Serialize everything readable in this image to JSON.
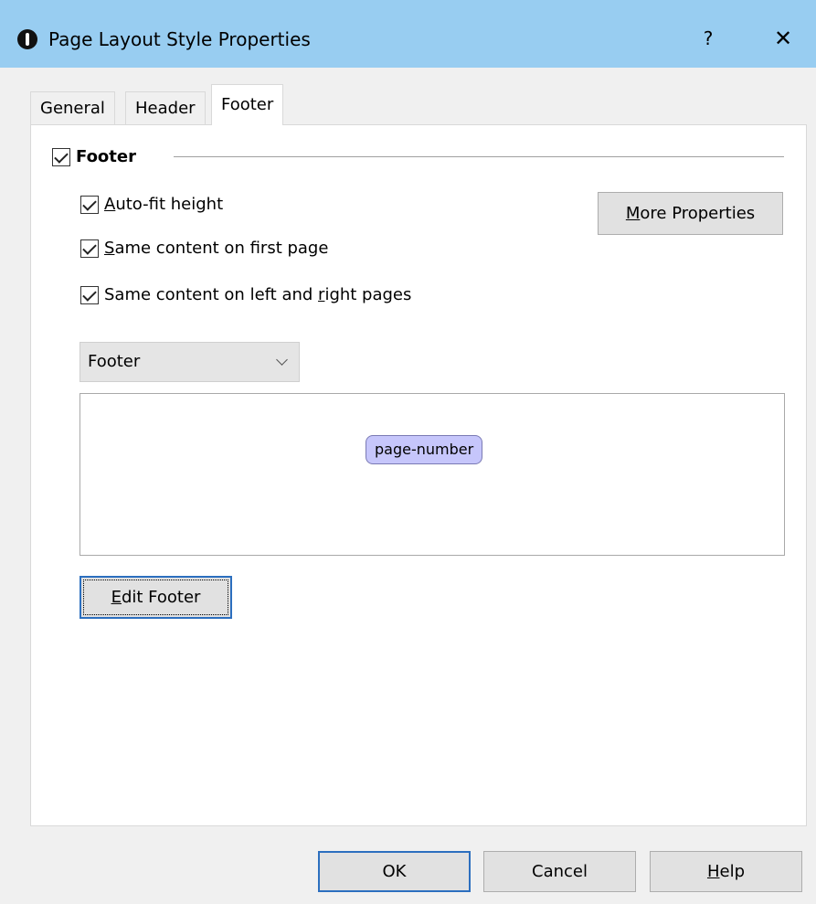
{
  "window": {
    "title": "Page Layout Style Properties",
    "help_glyph": "?",
    "close_glyph": "✕",
    "icon": "info-icon"
  },
  "tabs": [
    {
      "label": "General",
      "active": false
    },
    {
      "label": "Header",
      "active": false
    },
    {
      "label": "Footer",
      "active": true
    }
  ],
  "footer_section": {
    "label": "Footer",
    "checked": true
  },
  "options": [
    {
      "before": "",
      "key": "A",
      "after": "uto-fit height",
      "checked": true
    },
    {
      "before": "",
      "key": "S",
      "after": "ame content on first page",
      "checked": true
    },
    {
      "before": "Same content on left and ",
      "key": "r",
      "after": "ight pages",
      "checked": true
    }
  ],
  "more_properties": {
    "before": "",
    "key": "M",
    "after": "ore Properties"
  },
  "section_select": {
    "value": "Footer"
  },
  "preview": {
    "token": "page-number",
    "token_color": "#c6c6fb"
  },
  "edit_button": {
    "before": "",
    "key": "E",
    "after": "dit Footer"
  },
  "footer_buttons": {
    "ok": "OK",
    "cancel": "Cancel",
    "help": {
      "before": "",
      "key": "H",
      "after": "elp"
    }
  },
  "colors": {
    "titlebar": "#98cdf1",
    "default_button_border": "#2c6fbf"
  }
}
